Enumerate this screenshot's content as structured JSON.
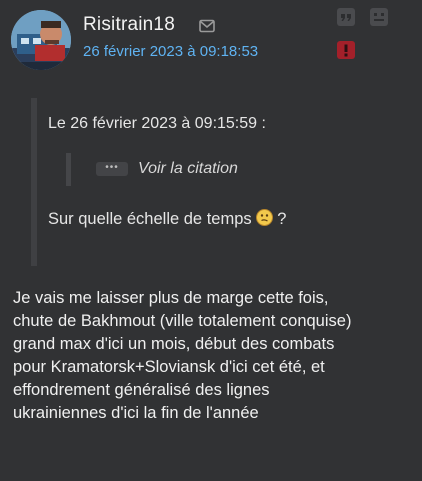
{
  "author": {
    "username": "Risitrain18",
    "avatar_icon": "avatar-train-image",
    "message_icon": "envelope-icon"
  },
  "post": {
    "timestamp": "26 février 2023 à 09:18:53",
    "actions": {
      "quote_icon": "quote-icon",
      "smiley_icon": "smiley-icon",
      "report_icon": "exclamation-icon"
    }
  },
  "quote": {
    "header": "Le 26 février 2023 à 09:15:59 :",
    "nested_button": "•••",
    "see_quote": "Voir la citation",
    "question": "Sur quelle échelle de temps",
    "question_suffix": " ?",
    "emoji_icon": "thinking-smiley-icon"
  },
  "message": {
    "lines": [
      "Je vais me laisser plus de marge cette fois,",
      "chute de Bakhmout (ville totalement conquise)",
      "grand max d'ici un mois, début des combats",
      "pour Kramatorsk+Sloviansk d'ici cet été, et",
      "effondrement généralisé des lignes",
      "ukrainiennes d'ici la fin de l'année"
    ]
  },
  "colors": {
    "background": "#313234",
    "timestamp": "#5fb3f2",
    "text": "#f0f0f0",
    "report": "#a3202a"
  }
}
